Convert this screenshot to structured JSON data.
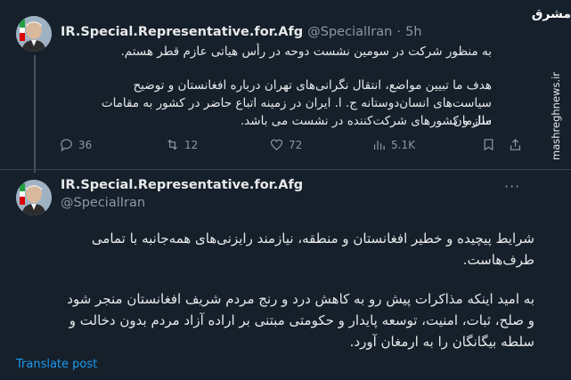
{
  "watermark": {
    "logo": "مشرق",
    "url": "mashreghnews.ir"
  },
  "tweet1": {
    "author_name": "IR.Special.Representative.for.Afg",
    "handle": "@SpecialIran",
    "separator": "·",
    "time": "5h",
    "paragraph1": "به منظور شرکت در سومین نشست دوحه در رأس هیاتی عازم قطر هستم.",
    "paragraph2_line1": "هدف ما تبیین مواضع، انتقال نگرانی‌های تهران درباره افغانستان و توضیح",
    "paragraph2_line2": "سیاست‌های انسان‌دوستانه ج. ا. ایران در زمینه اتباع حاضر در کشور به مقامات سازمان",
    "paragraph2_line3": "ملل و کشورهای شرکت‌کننده در نشست می باشد.",
    "replies": "36",
    "reposts": "12",
    "likes": "72",
    "views": "5.1K"
  },
  "tweet2": {
    "author_name": "IR.Special.Representative.for.Afg",
    "handle": "@SpecialIran",
    "more": "···",
    "para1_line1": "شرایط پیچیده و خطیر افغانستان و منطقه، نیازمند رایزنی‌های همه‌جانبه با تمامی",
    "para1_line2": "طرف‌هاست.",
    "para2_line1": "به امید اینکه مذاکرات پیش رو به کاهش درد و رنج مردم شریف افغانستان منجر شود",
    "para2_line2": "و صلح، ثبات، امنیت، توسعه پایدار و حکومتی مبتنی بر اراده آزاد مردم بدون دخالت و",
    "para2_line3": "سلطه بیگانگان را به ارمغان آورد.",
    "translate_label": "Translate post"
  }
}
